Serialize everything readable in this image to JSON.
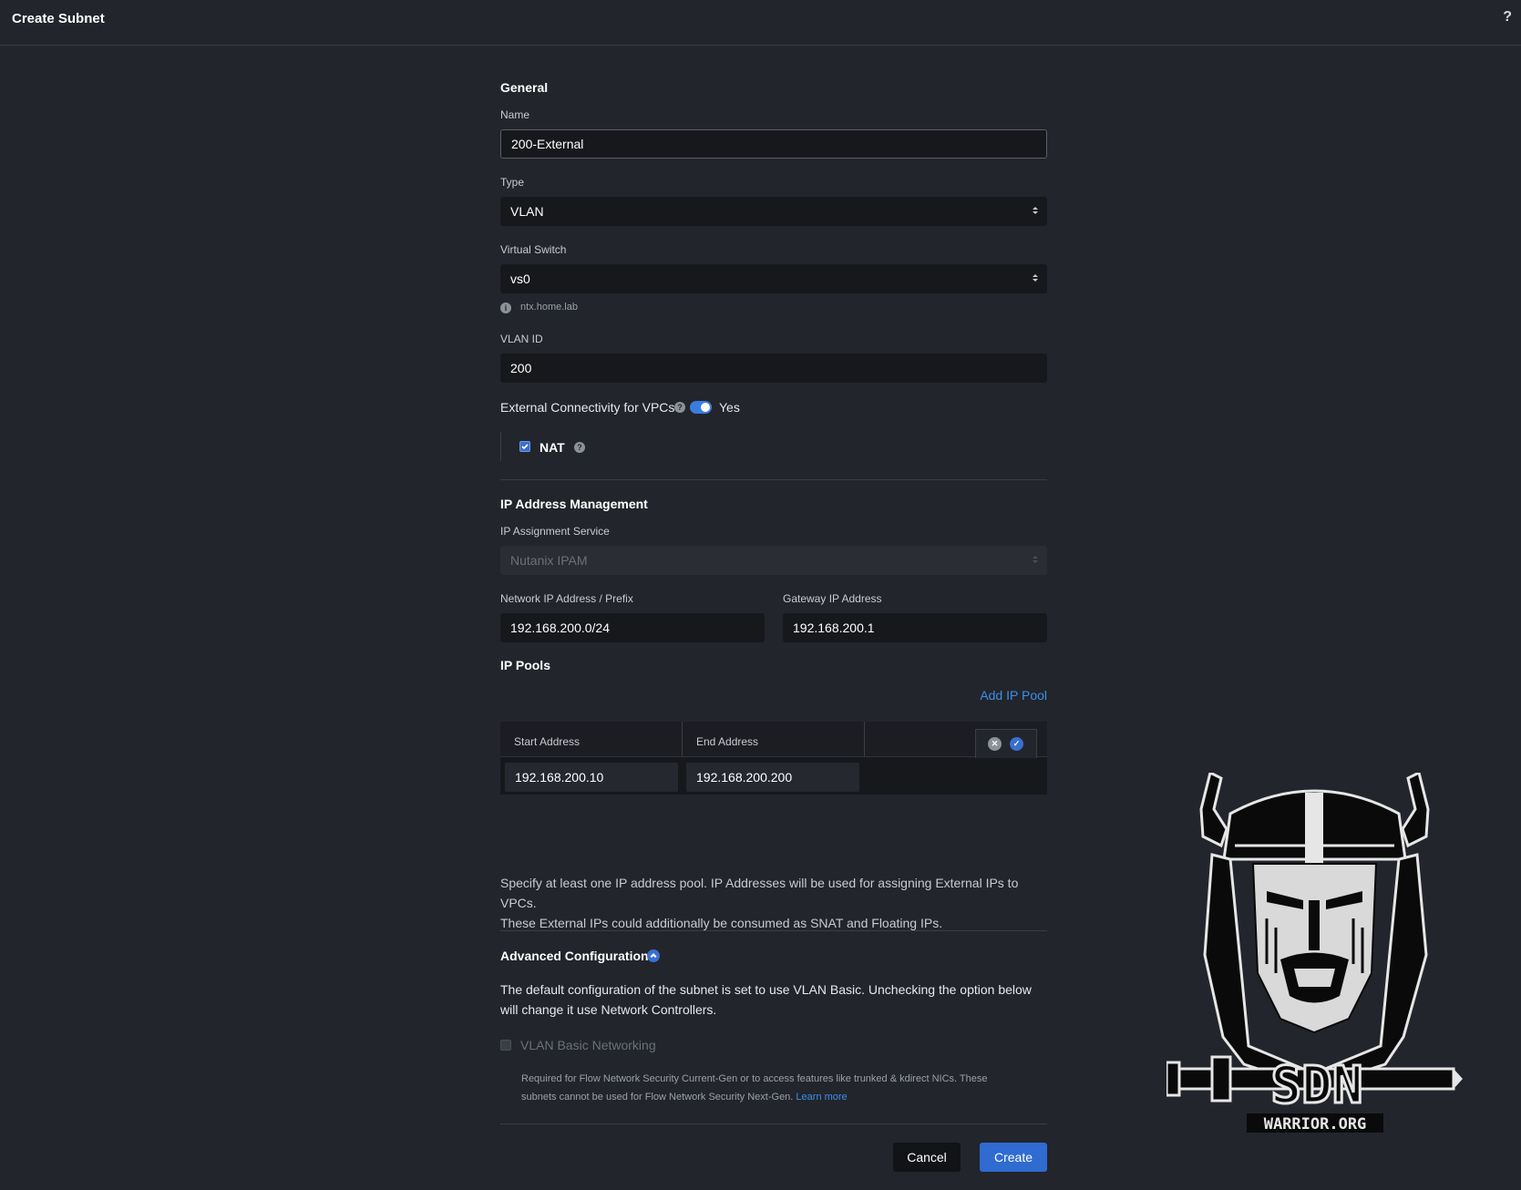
{
  "header": {
    "title": "Create Subnet",
    "help": "?"
  },
  "general": {
    "title": "General",
    "name_label": "Name",
    "name_value": "200-External",
    "type_label": "Type",
    "type_value": "VLAN",
    "vswitch_label": "Virtual Switch",
    "vswitch_value": "vs0",
    "vswitch_hint": "ntx.home.lab",
    "vlan_label": "VLAN ID",
    "vlan_value": "200",
    "external_label": "External Connectivity for VPCs",
    "external_state": "Yes",
    "nat_label": "NAT"
  },
  "ipam": {
    "title": "IP Address Management",
    "service_label": "IP Assignment Service",
    "service_value": "Nutanix IPAM",
    "network_label": "Network IP Address / Prefix",
    "network_value": "192.168.200.0/24",
    "gateway_label": "Gateway IP Address",
    "gateway_value": "192.168.200.1",
    "pools_title": "IP Pools",
    "add_pool": "Add IP Pool",
    "columns": [
      "Start Address",
      "End Address"
    ],
    "pool": {
      "start": "192.168.200.10",
      "end": "192.168.200.200"
    },
    "pool_note_1": "Specify at least one IP address pool. IP Addresses will be used for assigning External IPs to VPCs.",
    "pool_note_2": "These External IPs could additionally be consumed as SNAT and Floating IPs."
  },
  "advanced": {
    "title": "Advanced Configuration",
    "desc_1": "The default configuration of the subnet is set to use VLAN Basic. Unchecking the option below",
    "desc_2": "will change it use Network Controllers.",
    "vlan_basic_label": "VLAN Basic Networking",
    "note_1": "Required for Flow Network Security Current-Gen or to access features like trunked & kdirect NICs. These",
    "note_2": "subnets cannot be used for Flow Network Security Next-Gen.",
    "learn_more": "Learn more"
  },
  "footer": {
    "cancel": "Cancel",
    "create": "Create"
  },
  "watermark": {
    "text": "WARRIOR.ORG",
    "letters": "SDN"
  },
  "colors": {
    "accent": "#3b6ecf",
    "background": "#22252b",
    "input": "#16181c"
  }
}
